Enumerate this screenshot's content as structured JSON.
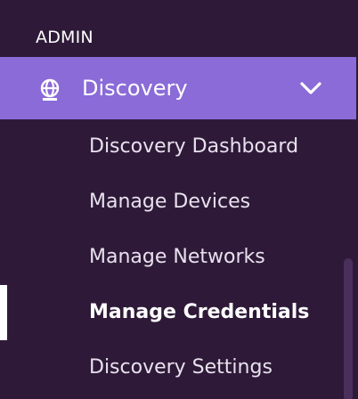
{
  "section": {
    "heading": "ADMIN"
  },
  "nav": {
    "group": {
      "label": "Discovery",
      "icon": "globe-icon",
      "expanded": true,
      "toggle_icon": "chevron-down-icon"
    },
    "items": [
      {
        "label": "Discovery Dashboard",
        "active": false
      },
      {
        "label": "Manage Devices",
        "active": false
      },
      {
        "label": "Manage Networks",
        "active": false
      },
      {
        "label": "Manage Credentials",
        "active": true
      },
      {
        "label": "Discovery Settings",
        "active": false
      }
    ]
  },
  "colors": {
    "background": "#2e1a38",
    "highlight": "#8a6bd8",
    "text": "#ffffff"
  }
}
